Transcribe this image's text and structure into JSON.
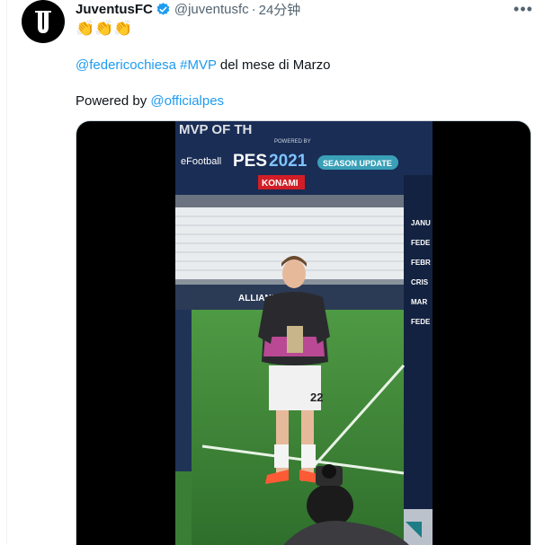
{
  "tweet": {
    "author_name": "JuventusFC",
    "handle": "@juventusfc",
    "separator": "·",
    "time": "24分钟",
    "more_label": "•••",
    "claps": "👏👏👏",
    "mention_chiesa": "@federicochiesa",
    "hashtag_mvp": "#MVP",
    "text_rest": " del mese di Marzo",
    "powered_by_label": "Powered by ",
    "mention_pes": "@officialpes"
  },
  "media": {
    "banner_top": "MVP OF TH",
    "powered_by_small": "POWERED BY",
    "efootball": "eFootball",
    "pes": "PES",
    "year": "2021",
    "season_update": "SEASON UPDATE",
    "konami": "KONAMI",
    "side_panel_lines": [
      "JANU",
      "FEDE",
      "FEBR",
      "CRIS",
      "MAR",
      "FEDE"
    ],
    "ad_board_text": "ALLIANZ",
    "shirt_number": "22"
  },
  "colors": {
    "accent": "#1d9bf0",
    "verified": "#1d9bf0",
    "pitch": "#3f8a3a",
    "banner": "#1a2d55"
  },
  "icons": {
    "avatar": "juventus-j-logo-icon",
    "verified": "verified-badge-icon",
    "more": "more-dots-icon"
  }
}
